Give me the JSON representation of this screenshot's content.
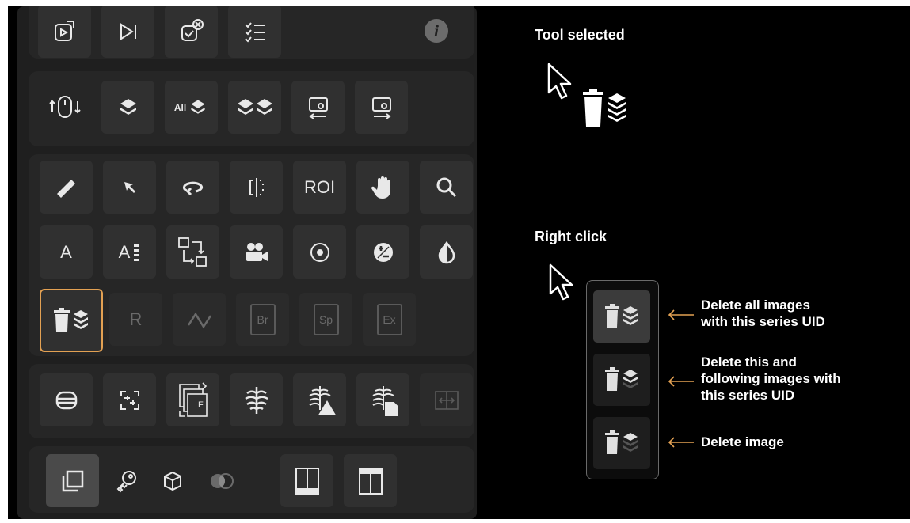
{
  "tool_selected_heading": "Tool selected",
  "right_click_heading": "Right click",
  "colors": {
    "accent_orange": "#e3a153",
    "panel_bg": "#1f1f1f",
    "button_bg": "#303030",
    "annotation_bg": "#000000"
  },
  "toolbar": {
    "row1_icons": [
      "tablet-play-icon",
      "play-step-icon",
      "tablet-cancel-icon",
      "checklist-icon",
      "info-icon"
    ],
    "info_label": "i",
    "row2_icons": [
      "mouse-scroll-icon",
      "layers-icon",
      "all-layers-icon",
      "double-layers-icon",
      "screen-left-icon",
      "screen-right-icon"
    ],
    "all_label": "All",
    "tools_label_roi": "ROI",
    "tools_label_a": "A",
    "tools_label_a2": "A",
    "tools_label_r": "R",
    "tools_label_br": "Br",
    "tools_label_sp": "Sp",
    "tools_label_ex": "Ex",
    "tools_label_f": "F"
  },
  "context_menu": {
    "items": [
      {
        "icon": "trash-layers-icon",
        "label": "Delete all images\nwith this series UID"
      },
      {
        "icon": "trash-layers-partial-icon",
        "label": "Delete this and\nfollowing images with\nthis series UID"
      },
      {
        "icon": "trash-layer-single-icon",
        "label": "Delete image"
      }
    ]
  },
  "labels": {
    "delete_all_l1": "Delete all images",
    "delete_all_l2": "with this series UID",
    "delete_following_l1": "Delete this and",
    "delete_following_l2": "following images with",
    "delete_following_l3": "this series UID",
    "delete_image": "Delete image"
  }
}
